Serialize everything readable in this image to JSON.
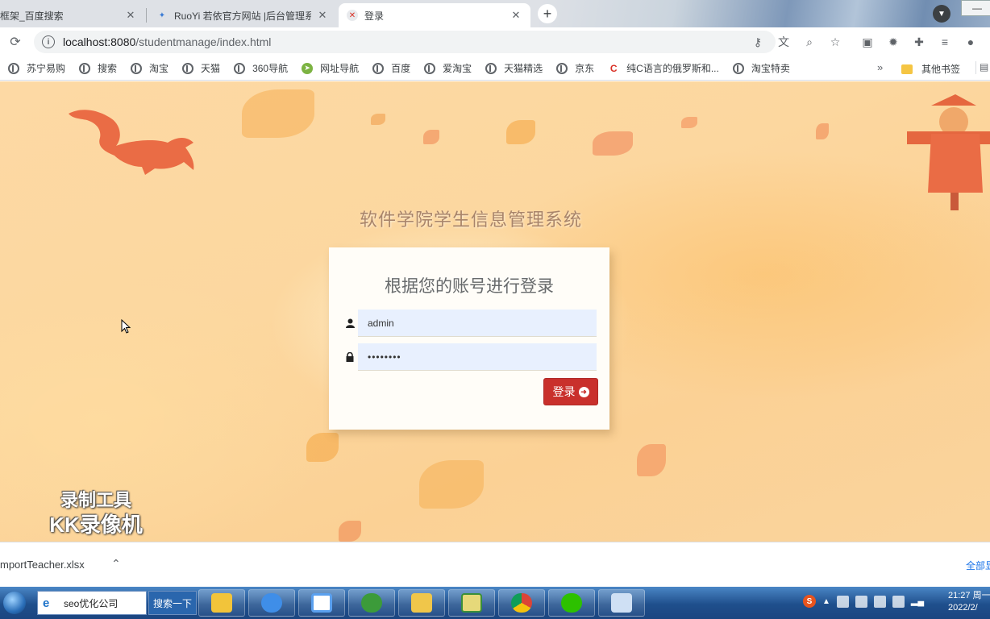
{
  "browser": {
    "tabs": [
      {
        "label": "框架_百度搜索",
        "active": false
      },
      {
        "label": "RuoYi 若依官方网站 |后台管理系",
        "active": false
      },
      {
        "label": "登录",
        "active": true
      }
    ],
    "new_tab_symbol": "+",
    "url_host": "localhost:8080",
    "url_path": "/studentmanage/index.html",
    "bookmarks": [
      {
        "label": "苏宁易购",
        "icon": "globe-icon"
      },
      {
        "label": "搜索",
        "icon": "globe-icon"
      },
      {
        "label": "淘宝",
        "icon": "globe-icon"
      },
      {
        "label": "天猫",
        "icon": "globe-icon"
      },
      {
        "label": "360导航",
        "icon": "globe-icon"
      },
      {
        "label": "网址导航",
        "icon": "nav-icon"
      },
      {
        "label": "百度",
        "icon": "globe-icon"
      },
      {
        "label": "爱淘宝",
        "icon": "globe-icon"
      },
      {
        "label": "天猫精选",
        "icon": "globe-icon"
      },
      {
        "label": "京东",
        "icon": "globe-icon"
      },
      {
        "label": "纯C语言的俄罗斯和...",
        "icon": "csdn-icon"
      },
      {
        "label": "淘宝特卖",
        "icon": "globe-icon"
      }
    ],
    "bookmarks_more": "»",
    "other_bookmarks": "其他书签"
  },
  "page": {
    "system_title": "软件学院学生信息管理系统",
    "login_heading": "根据您的账号进行登录",
    "username_value": "admin",
    "password_value": "••••••••",
    "login_button_label": "登录"
  },
  "watermark": {
    "line1": "录制工具",
    "line2": "KK录像机"
  },
  "download_bar": {
    "file_name": "mportTeacher.xlsx",
    "show_all": "全部显"
  },
  "taskbar": {
    "search_text": "seo优化公司",
    "search_button": "搜索一下",
    "clock_time": "21:27 周一",
    "clock_date": "2022/2/"
  },
  "colors": {
    "login_button": "#c9302c",
    "page_background": "#fcd79f",
    "taskbar": "#1f4f8c"
  }
}
